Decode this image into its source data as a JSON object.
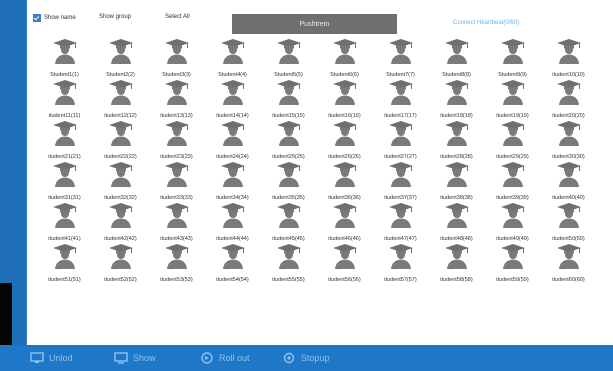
{
  "toolbar": {
    "show_name_label": "Show name",
    "show_name_checked": true,
    "show_group_label": "Show group",
    "select_all_label": "Select All",
    "push_button_label": "Pushtrem",
    "connection_link_label": "Connect Heartbeat(0/60)"
  },
  "students": [
    "Student1(1)",
    "Student2(2)",
    "Student3(3)",
    "Student4(4)",
    "Student5(5)",
    "Student6(6)",
    "Student7(7)",
    "Student8(8)",
    "Student9(9)",
    "itudent10(10)",
    "itudent11(11)",
    "itudent12(12)",
    "itudent13(13)",
    "itudent14(14)",
    "itudent15(15)",
    "itudent16(16)",
    "itudent17(17)",
    "itudent18(18)",
    "itudent19(19)",
    "itudent20(20)",
    "itudent21(21)",
    "itudent22(22)",
    "itudent23(23)",
    "itudent24(24)",
    "itudent25(25)",
    "itudent26(26)",
    "itudent27(27)",
    "itudent28(28)",
    "itudent29(29)",
    "itudent30(30)",
    "itudent31(31)",
    "itudent32(32)",
    "itudent33(33)",
    "itudent34(34)",
    "itudent35(35)",
    "itudent36(36)",
    "itudent37(37)",
    "itudent38(38)",
    "itudent39(39)",
    "itudent40(40)",
    "itudent41(41)",
    "itudent42(42)",
    "itudent43(43)",
    "itudent44(44)",
    "itudent45(45)",
    "itudent46(46)",
    "itudent47(47)",
    "itudent48(48)",
    "itudent49(49)",
    "itudent50(50)",
    "itudent51(51)",
    "itudent52(52)",
    "itudent53(53)",
    "itudent54(54)",
    "itudent55(55)",
    "itudent56(56)",
    "itudent57(57)",
    "itudent58(58)",
    "itudent59(59)",
    "itudent60(60)"
  ],
  "student_icon": "graduate-avatar-icon",
  "bottom_bar": [
    {
      "label": "Unlod",
      "icon": "monitor-icon"
    },
    {
      "label": "Show",
      "icon": "screen-icon"
    },
    {
      "label": "Roll out",
      "icon": "rollout-icon"
    },
    {
      "label": "Stopup",
      "icon": "settings-icon"
    }
  ],
  "colors": {
    "accent_blue": "#1f77c8",
    "push_button_gray": "#6f6f6f",
    "avatar_gray": "#7a7a7a",
    "link_blue": "#6bb6e8"
  }
}
